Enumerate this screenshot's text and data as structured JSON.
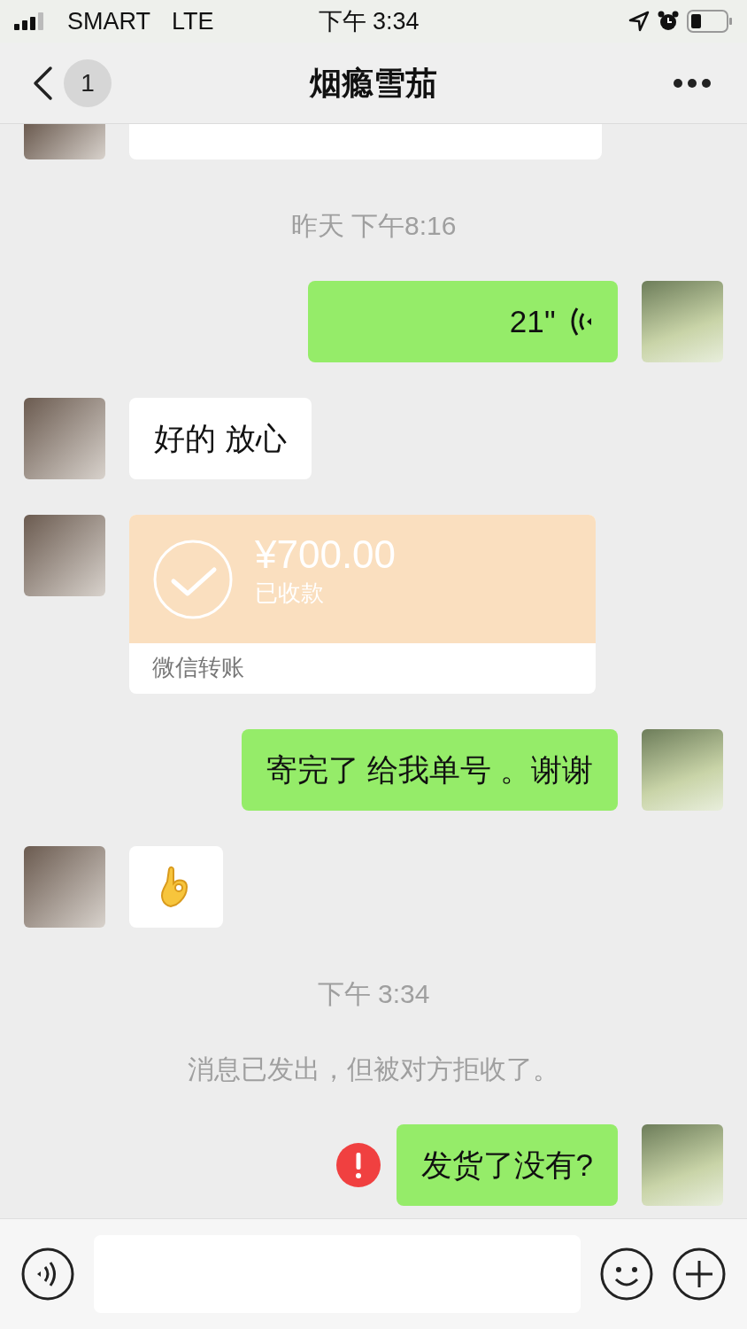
{
  "status_bar": {
    "carrier": "SMART",
    "network": "LTE",
    "time": "下午 3:34"
  },
  "header": {
    "unread": "1",
    "title": "烟瘾雪茄"
  },
  "messages": [
    {
      "kind": "cut",
      "outgoing": false
    },
    {
      "kind": "time",
      "text": "昨天 下午8:16"
    },
    {
      "kind": "voice",
      "outgoing": true,
      "duration": "21''"
    },
    {
      "kind": "text",
      "outgoing": false,
      "text": "好的 放心",
      "failed": false
    },
    {
      "kind": "transfer",
      "outgoing": false,
      "amount": "¥700.00",
      "status": "已收款",
      "source": "微信转账"
    },
    {
      "kind": "text",
      "outgoing": true,
      "text": "寄完了 给我单号 。谢谢",
      "failed": false
    },
    {
      "kind": "emoji",
      "outgoing": false
    },
    {
      "kind": "time",
      "text": "下午 3:34"
    },
    {
      "kind": "system",
      "text": "消息已发出，但被对方拒收了。"
    },
    {
      "kind": "text",
      "outgoing": true,
      "text": "发货了没有?",
      "failed": true
    }
  ]
}
